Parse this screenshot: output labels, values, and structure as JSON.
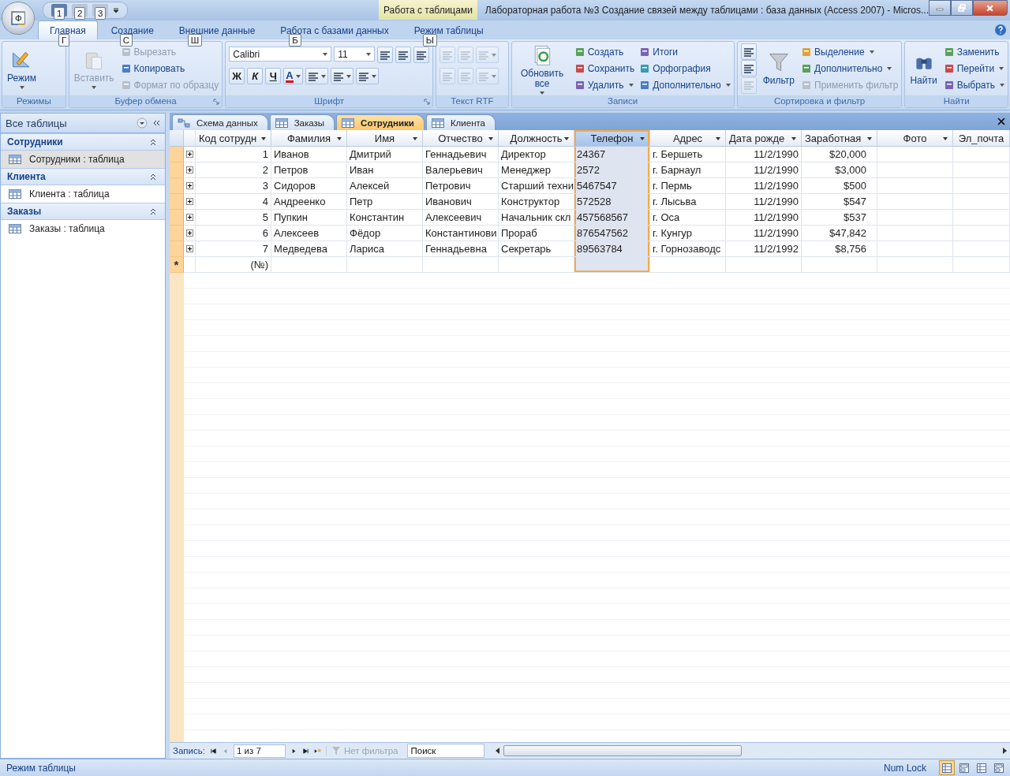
{
  "title_bar": {
    "office_keytip": "Ф",
    "quick_access": [
      {
        "keytip": "1",
        "disabled": false
      },
      {
        "keytip": "2",
        "disabled": true
      },
      {
        "keytip": "3",
        "disabled": true
      }
    ],
    "context_tab": "Работа с таблицами",
    "title": "Лабораторная работа №3 Создание связей между таблицами : база данных (Access 2007) - Micros..."
  },
  "ribbon_tabs": [
    {
      "label": "Главная",
      "keytip": "Г",
      "selected": true
    },
    {
      "label": "Создание",
      "keytip": "С",
      "selected": false
    },
    {
      "label": "Внешние данные",
      "keytip": "Ш",
      "selected": false
    },
    {
      "label": "Работа с базами данных",
      "keytip": "Б",
      "selected": false
    },
    {
      "label": "Режим таблицы",
      "keytip": "Ы",
      "selected": false
    }
  ],
  "ribbon_groups": [
    {
      "title": "Режимы",
      "launcher": false,
      "kind": "columns",
      "columns": [
        [
          {
            "kind": "large",
            "label": "Режим",
            "dropdown": true,
            "disabled": false
          }
        ]
      ]
    },
    {
      "title": "Буфер обмена",
      "launcher": true,
      "kind": "columns",
      "columns": [
        [
          {
            "kind": "large",
            "label": "Вставить",
            "dropdown": true,
            "disabled": true
          }
        ],
        [
          {
            "kind": "small",
            "label": "Вырезать",
            "dropdown": false,
            "disabled": true
          },
          {
            "kind": "small",
            "label": "Копировать",
            "dropdown": false,
            "disabled": false
          },
          {
            "kind": "small",
            "label": "Формат по образцу",
            "dropdown": false,
            "disabled": true
          }
        ]
      ]
    },
    {
      "title": "Шрифт",
      "launcher": true,
      "kind": "rows",
      "columns": [
        [
          {
            "kind": "combo",
            "value": "Calibri"
          },
          {
            "kind": "combo",
            "value": "11"
          },
          {
            "kind": "icon",
            "dropdown": false,
            "disabled": false
          },
          {
            "kind": "icon",
            "dropdown": false,
            "disabled": false
          },
          {
            "kind": "icon",
            "dropdown": false,
            "disabled": false
          }
        ],
        [
          {
            "kind": "glyph",
            "label": "Ж",
            "dropdown": false,
            "disabled": false
          },
          {
            "kind": "glyph",
            "label": "К",
            "dropdown": false,
            "disabled": false
          },
          {
            "kind": "glyph",
            "label": "Ч",
            "dropdown": false,
            "disabled": false
          },
          {
            "kind": "font-color",
            "label": "A",
            "dropdown": true,
            "disabled": false
          },
          {
            "kind": "icon",
            "dropdown": true,
            "disabled": false
          },
          {
            "kind": "icon",
            "dropdown": true,
            "disabled": false
          },
          {
            "kind": "icon",
            "dropdown": true,
            "disabled": false
          }
        ]
      ]
    },
    {
      "title": "Текст RTF",
      "launcher": false,
      "kind": "rows",
      "columns": [
        [
          {
            "kind": "icon",
            "dropdown": false,
            "disabled": true
          },
          {
            "kind": "icon",
            "dropdown": false,
            "disabled": true
          },
          {
            "kind": "icon",
            "dropdown": true,
            "disabled": true
          }
        ],
        [
          {
            "kind": "icon",
            "dropdown": false,
            "disabled": true
          },
          {
            "kind": "icon",
            "dropdown": false,
            "disabled": true
          },
          {
            "kind": "icon",
            "dropdown": true,
            "disabled": true
          }
        ]
      ]
    },
    {
      "title": "Записи",
      "launcher": false,
      "kind": "columns",
      "columns": [
        [
          {
            "kind": "large",
            "label": "Обновить все",
            "dropdown": true,
            "disabled": false
          }
        ],
        [
          {
            "kind": "small",
            "label": "Создать",
            "dropdown": false,
            "disabled": false
          },
          {
            "kind": "small",
            "label": "Сохранить",
            "dropdown": false,
            "disabled": false
          },
          {
            "kind": "small",
            "label": "Удалить",
            "dropdown": true,
            "disabled": false
          }
        ],
        [
          {
            "kind": "small",
            "label": "Итоги",
            "dropdown": false,
            "disabled": false
          },
          {
            "kind": "small",
            "label": "Орфография",
            "dropdown": false,
            "disabled": false
          },
          {
            "kind": "small",
            "label": "Дополнительно",
            "dropdown": true,
            "disabled": false
          }
        ]
      ]
    },
    {
      "title": "Сортировка и фильтр",
      "launcher": false,
      "kind": "columns",
      "columns": [
        [
          {
            "kind": "icon",
            "dropdown": false,
            "disabled": false
          },
          {
            "kind": "icon",
            "dropdown": false,
            "disabled": false
          },
          {
            "kind": "icon",
            "dropdown": false,
            "disabled": true
          }
        ],
        [
          {
            "kind": "large",
            "label": "Фильтр",
            "dropdown": false,
            "disabled": false
          }
        ],
        [
          {
            "kind": "small",
            "label": "Выделение",
            "dropdown": true,
            "disabled": false
          },
          {
            "kind": "small",
            "label": "Дополнительно",
            "dropdown": true,
            "disabled": false
          },
          {
            "kind": "small",
            "label": "Применить фильтр",
            "dropdown": false,
            "disabled": true
          }
        ]
      ]
    },
    {
      "title": "Найти",
      "launcher": false,
      "kind": "columns",
      "columns": [
        [
          {
            "kind": "large",
            "label": "Найти",
            "dropdown": false,
            "disabled": false
          }
        ],
        [
          {
            "kind": "small",
            "label": "Заменить",
            "dropdown": false,
            "disabled": false
          },
          {
            "kind": "small",
            "label": "Перейти",
            "dropdown": true,
            "disabled": false
          },
          {
            "kind": "small",
            "label": "Выбрать",
            "dropdown": true,
            "disabled": false
          }
        ]
      ]
    }
  ],
  "navigation_pane": {
    "header": "Все таблицы",
    "groups": [
      {
        "title": "Сотрудники",
        "items": [
          {
            "label": "Сотрудники : таблица",
            "selected": true
          }
        ]
      },
      {
        "title": "Клиента",
        "items": [
          {
            "label": "Клиента : таблица",
            "selected": false
          }
        ]
      },
      {
        "title": "Заказы",
        "items": [
          {
            "label": "Заказы : таблица",
            "selected": false
          }
        ]
      }
    ]
  },
  "object_tabs": [
    {
      "label": "Схема данных",
      "kind": "diagram",
      "selected": false
    },
    {
      "label": "Заказы",
      "kind": "table",
      "selected": false
    },
    {
      "label": "Сотрудники",
      "kind": "table",
      "selected": true
    },
    {
      "label": "Клиента",
      "kind": "table",
      "selected": false
    }
  ],
  "table": {
    "columns": [
      {
        "label": "Код сотрудн",
        "kind": "number",
        "selected": false
      },
      {
        "label": "Фамилия",
        "kind": "text",
        "selected": false
      },
      {
        "label": "Имя",
        "kind": "text",
        "selected": false
      },
      {
        "label": "Отчество",
        "kind": "text",
        "selected": false
      },
      {
        "label": "Должность",
        "kind": "text",
        "selected": false
      },
      {
        "label": "Телефон",
        "kind": "text",
        "selected": true
      },
      {
        "label": "Адрес",
        "kind": "text",
        "selected": false
      },
      {
        "label": "Дата рожде",
        "kind": "date",
        "selected": false
      },
      {
        "label": "Заработная",
        "kind": "currency",
        "selected": false
      },
      {
        "label": "Фото",
        "kind": "text",
        "selected": false
      },
      {
        "label": "Эл_почта",
        "kind": "text",
        "selected": false
      }
    ],
    "rows": [
      {
        "expanded": false,
        "cells": [
          "1",
          "Иванов",
          "Дмитрий",
          "Геннадьевич",
          "Директор",
          "24367",
          "г. Бершеть",
          "11/2/1990",
          "$20,000"
        ]
      },
      {
        "expanded": false,
        "cells": [
          "2",
          "Петров",
          "Иван",
          "Валерьевич",
          "Менеджер",
          "2572",
          "г. Барнаул",
          "11/2/1990",
          "$3,000"
        ]
      },
      {
        "expanded": false,
        "cells": [
          "3",
          "Сидоров",
          "Алексей",
          "Петрович",
          "Старший техни",
          "5467547",
          "г. Пермь",
          "11/2/1990",
          "$500"
        ]
      },
      {
        "expanded": false,
        "cells": [
          "4",
          "Андреенко",
          "Петр",
          "Иванович",
          "Конструктор",
          "572528",
          "г. Лысьва",
          "11/2/1990",
          "$547"
        ]
      },
      {
        "expanded": false,
        "cells": [
          "5",
          "Пупкин",
          "Константин",
          "Алексеевич",
          "Начальник скл",
          "457568567",
          "г. Оса",
          "11/2/1990",
          "$537"
        ]
      },
      {
        "expanded": false,
        "cells": [
          "6",
          "Алексеев",
          "Фёдор",
          "Константинови",
          "Прораб",
          "876547562",
          "г. Кунгур",
          "11/2/1990",
          "$47,842"
        ]
      },
      {
        "expanded": false,
        "cells": [
          "7",
          "Медведева",
          "Лариса",
          "Геннадьевна",
          "Секретарь",
          "89563784",
          "г. Горнозаводс",
          "11/2/1992",
          "$8,756"
        ]
      }
    ],
    "new_record": {
      "marker": "*",
      "placeholder": "(№)"
    }
  },
  "record_navigator": {
    "label": "Запись:",
    "position": "1 из 7",
    "filter": "Нет фильтра",
    "search": {
      "placeholder": "Поиск"
    }
  },
  "status_bar": {
    "mode": "Режим таблицы",
    "num_lock": "Num Lock",
    "views": [
      {
        "selected": true
      },
      {
        "selected": false
      },
      {
        "selected": false
      },
      {
        "selected": false
      }
    ]
  }
}
